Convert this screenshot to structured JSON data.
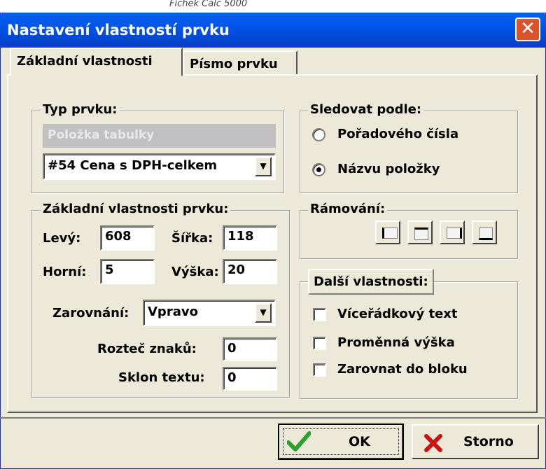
{
  "window": {
    "top_clipped_text": "Fichek Calc 5000",
    "title": "Nastavení vlastností prvku",
    "close_symbol": "✕"
  },
  "tabs": [
    {
      "label": "Základní vlastnosti"
    },
    {
      "label": "Písmo prvku"
    }
  ],
  "type_group": {
    "label": "Typ prvku:",
    "disabled_value": "Položka tabulky",
    "select_value": "#54 Cena s DPH-celkem"
  },
  "follow_group": {
    "label": "Sledovat podle:",
    "options": [
      {
        "label": "Pořadového čísla",
        "selected": false
      },
      {
        "label": "Názvu položky",
        "selected": true
      }
    ]
  },
  "basic_group": {
    "label": "Základní vlastnosti prvku:",
    "left_label": "Levý:",
    "left_value": "608",
    "width_label": "Šířka:",
    "width_value": "118",
    "top_label": "Horní:",
    "top_value": "5",
    "height_label": "Výška:",
    "height_value": "20",
    "align_label": "Zarovnání:",
    "align_value": "Vpravo",
    "spacing_label": "Rozteč znaků:",
    "spacing_value": "0",
    "slant_label": "Sklon textu:",
    "slant_value": "0"
  },
  "frame_group": {
    "label": "Rámování:",
    "buttons": [
      "frame-left-icon",
      "frame-top-icon",
      "frame-right-icon",
      "frame-bottom-icon"
    ]
  },
  "more_group": {
    "label": "Další vlastnosti:",
    "options": [
      {
        "label": "Víceřádkový text",
        "checked": false
      },
      {
        "label": "Proměnná výška",
        "checked": false
      },
      {
        "label": "Zarovnat do bloku",
        "checked": false
      }
    ]
  },
  "buttons": {
    "ok": "OK",
    "cancel": "Storno"
  },
  "colors": {
    "titlebar": "#0058ee",
    "window_bg": "#ece9d8",
    "close_btn": "#d9532c",
    "ok_check": "#2ca02c",
    "cancel_x": "#cc1111"
  }
}
